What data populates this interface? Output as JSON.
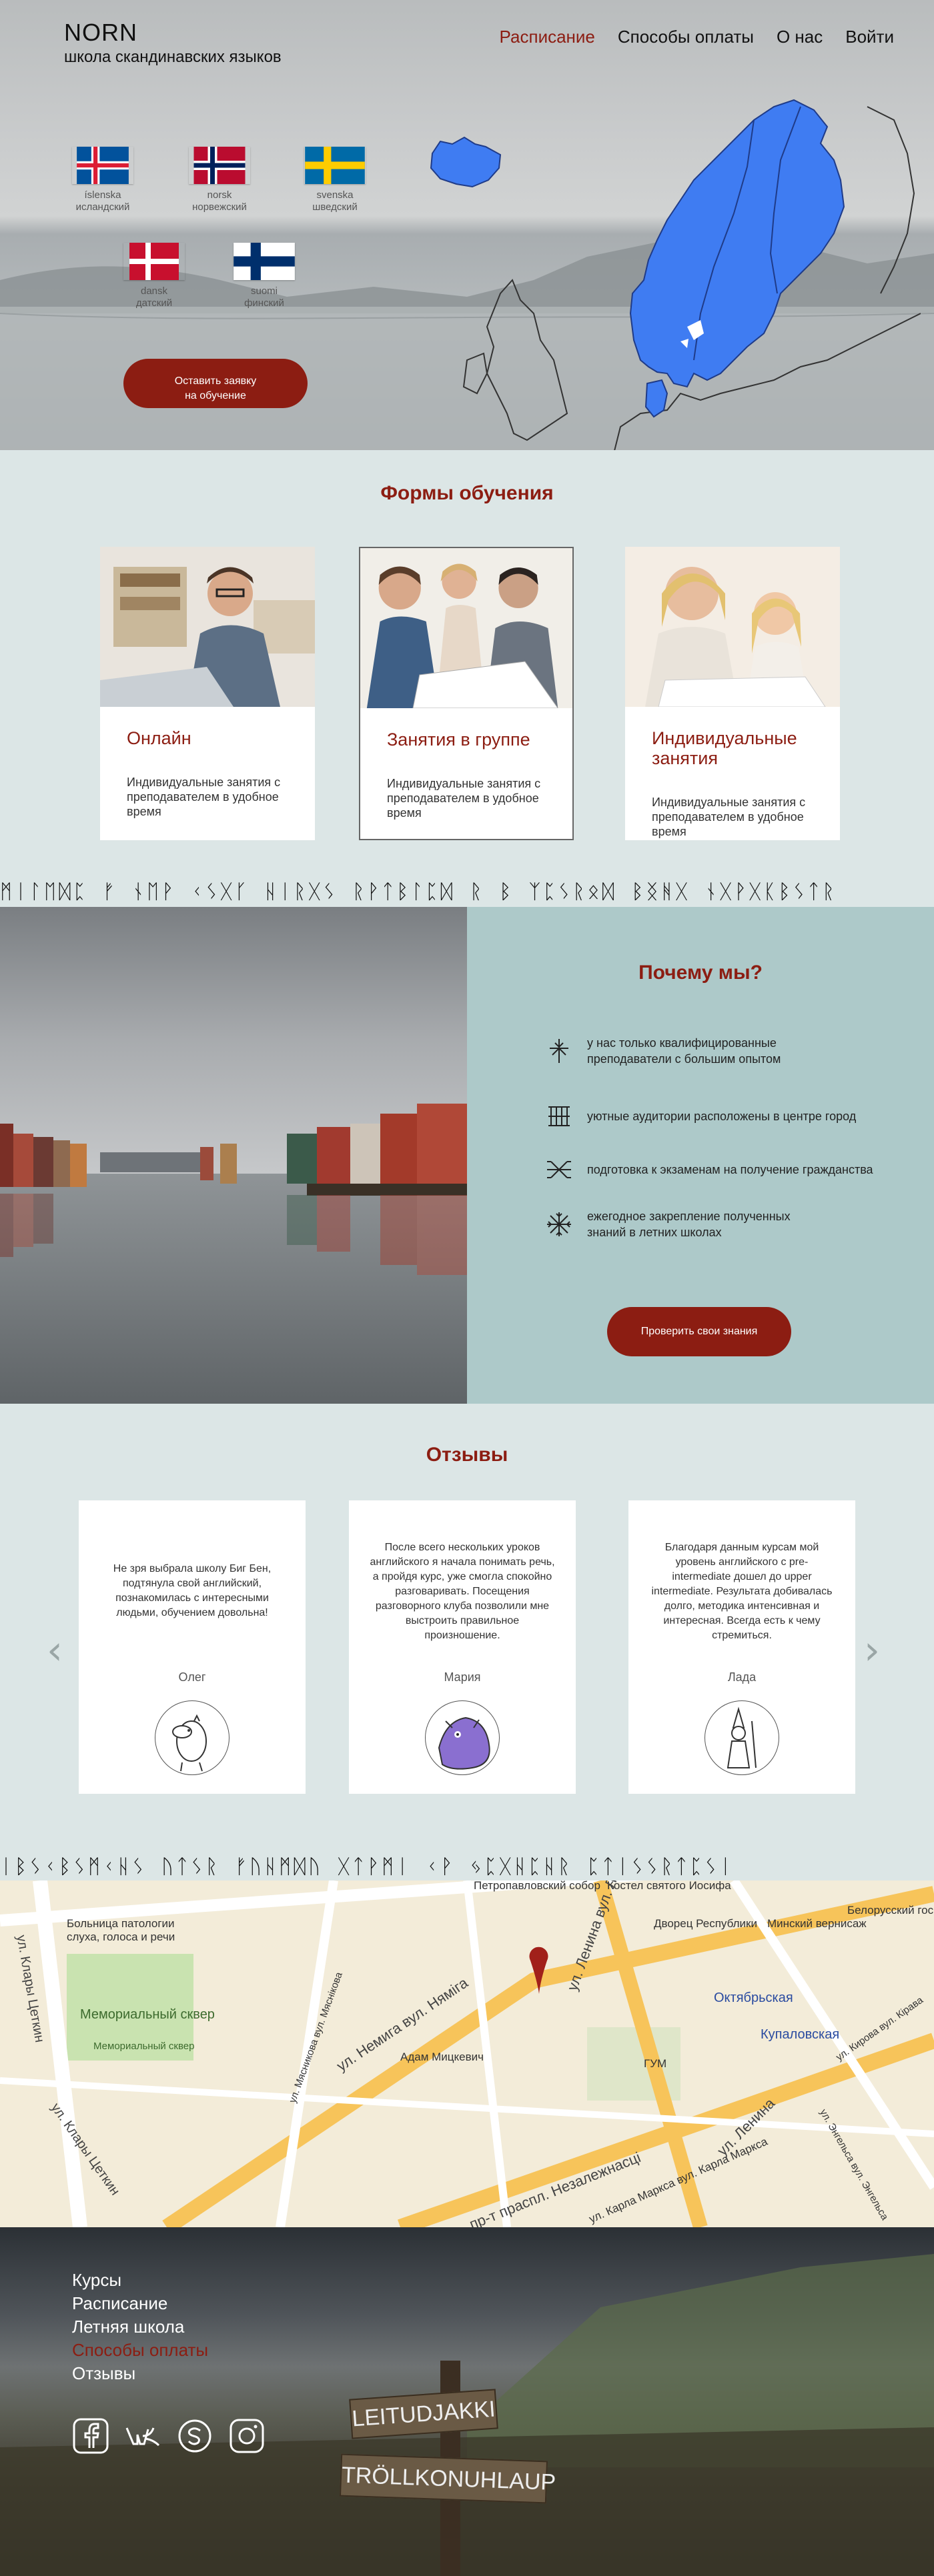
{
  "header": {
    "brand_name": "NORN",
    "brand_sub": "школа скандинавских языков",
    "nav": [
      "Расписание",
      "Способы оплаты",
      "О нас",
      "Войти"
    ]
  },
  "flags": [
    {
      "l1": "íslenska",
      "l2": "исландский",
      "icon": "iceland-flag-icon"
    },
    {
      "l1": "norsk",
      "l2": "норвежский",
      "icon": "norway-flag-icon"
    },
    {
      "l1": "svenska",
      "l2": "шведский",
      "icon": "sweden-flag-icon"
    },
    {
      "l1": "dansk",
      "l2": "датский",
      "icon": "denmark-flag-icon"
    },
    {
      "l1": "suomi",
      "l2": "финский",
      "icon": "finland-flag-icon"
    }
  ],
  "hero_cta": {
    "line1": "Оставить заявку",
    "line2": "на обучение"
  },
  "forms": {
    "title": "Формы обучения",
    "cards": [
      {
        "title": "Онлайн",
        "text": "Индивидуальные занятия с преподавателем в удобное время"
      },
      {
        "title": "Занятия в группе",
        "text": "Индивидуальные занятия с преподавателем в удобное время"
      },
      {
        "title": "Индивидуальные занятия",
        "text": "Индивидуальные занятия с преподавателем в удобное время"
      }
    ]
  },
  "runes_line1": "ᛗᛁᛚᛖᛞᛈ ᚠ ᚾᛖᚹ ᚲᛊᚷᚴ ᚺᛁᚱᚷᛊ ᚱᚹᛏᛒᛚᛈᛞ ᚱ ᛒ ᛉᛈᛊᚱᛟᛞ ᛒᛝᚻᚷ ᚾᚷᚹᚷᛕᛒᛊᛏᚱ",
  "runes_line2": "ᛁᛒᛊᚲᛒᛊᛗᚲᚺᛊ ᚢᛏᛊᚱ ᚠᚢᚺᛗᛞᚢ ᚷᛏᚹᛗᛁ ᚲᚹ ᛃᛈᚷᚺᛈᚺᚱ ᛈᛏᛁᛊᛊᚱᛏᛈᛊᛁ",
  "why": {
    "title": "Почему мы?",
    "items": [
      {
        "text": "у  нас только квалифицированные преподаватели с большим опытом",
        "icon": "rune-cross-icon"
      },
      {
        "text": "уютные аудитории расположены в центре город",
        "icon": "rune-grid-icon"
      },
      {
        "text": "подготовка к экзаменам на получение гражданства",
        "icon": "rune-branch-icon"
      },
      {
        "text": "ежегодное закрепление полученных знаний в летних школах",
        "icon": "rune-star-icon"
      }
    ],
    "cta": "Проверить свои знания"
  },
  "reviews": {
    "title": "Отзывы",
    "items": [
      {
        "text": "Не зря выбрала школу Биг Бен, подтянула свой английский, познакомилась с интересными людьми, обучением довольна!",
        "name": "Олег",
        "avatar": "moomin-avatar-icon"
      },
      {
        "text": "После всего нескольких уроков английского я начала понимать речь, а пройдя курс, уже смогла спокойно разговаривать. Посещения разговорного клуба позволили мне выстроить правильное произношение.",
        "name": "Мария",
        "avatar": "creature-avatar-icon"
      },
      {
        "text": "Благодаря данным курсам мой уровень английского с pre-intermediate дошел до upper intermediate. Результата добивалась долго, методика интенсивная и интересная. Всегда есть к чему стремиться.",
        "name": "Лада",
        "avatar": "snufkin-avatar-icon"
      }
    ]
  },
  "map": {
    "labels": [
      "Больница патологии слуха, голоса и речи",
      "Мемориальный сквер",
      "Мемориальный сквер",
      "ул. Клары Цеткин",
      "ул. Клары Цеткин",
      "ул. Немига вул. Няміга",
      "Адам Мицкевич",
      "Петропавловский собор",
      "Костел святого Иосифа",
      "ул. Ленина вул. Леніна",
      "Дворец Республики",
      "Минский вернисаж",
      "Белорусский гос...",
      "Октябрьская",
      "Купаловская",
      "ГУМ",
      "ул. Ленина",
      "пр-т праспл. Незалежнасці",
      "ул. Карла Маркса вул. Карла Маркса",
      "ул. Кирова вул. Кірава",
      "ул. Энгельса вул. Энгельса",
      "ул. Мясникова вул. Мяснікова"
    ]
  },
  "footer": {
    "links": [
      "Курсы",
      "Расписание",
      "Летняя школа",
      "Способы оплаты",
      "Отзывы"
    ],
    "social": [
      "facebook-icon",
      "vk-icon",
      "skype-icon",
      "instagram-icon"
    ],
    "sign1": "LEITUDJAKKI",
    "sign2": "TRÖLLKONUHLAUP"
  }
}
